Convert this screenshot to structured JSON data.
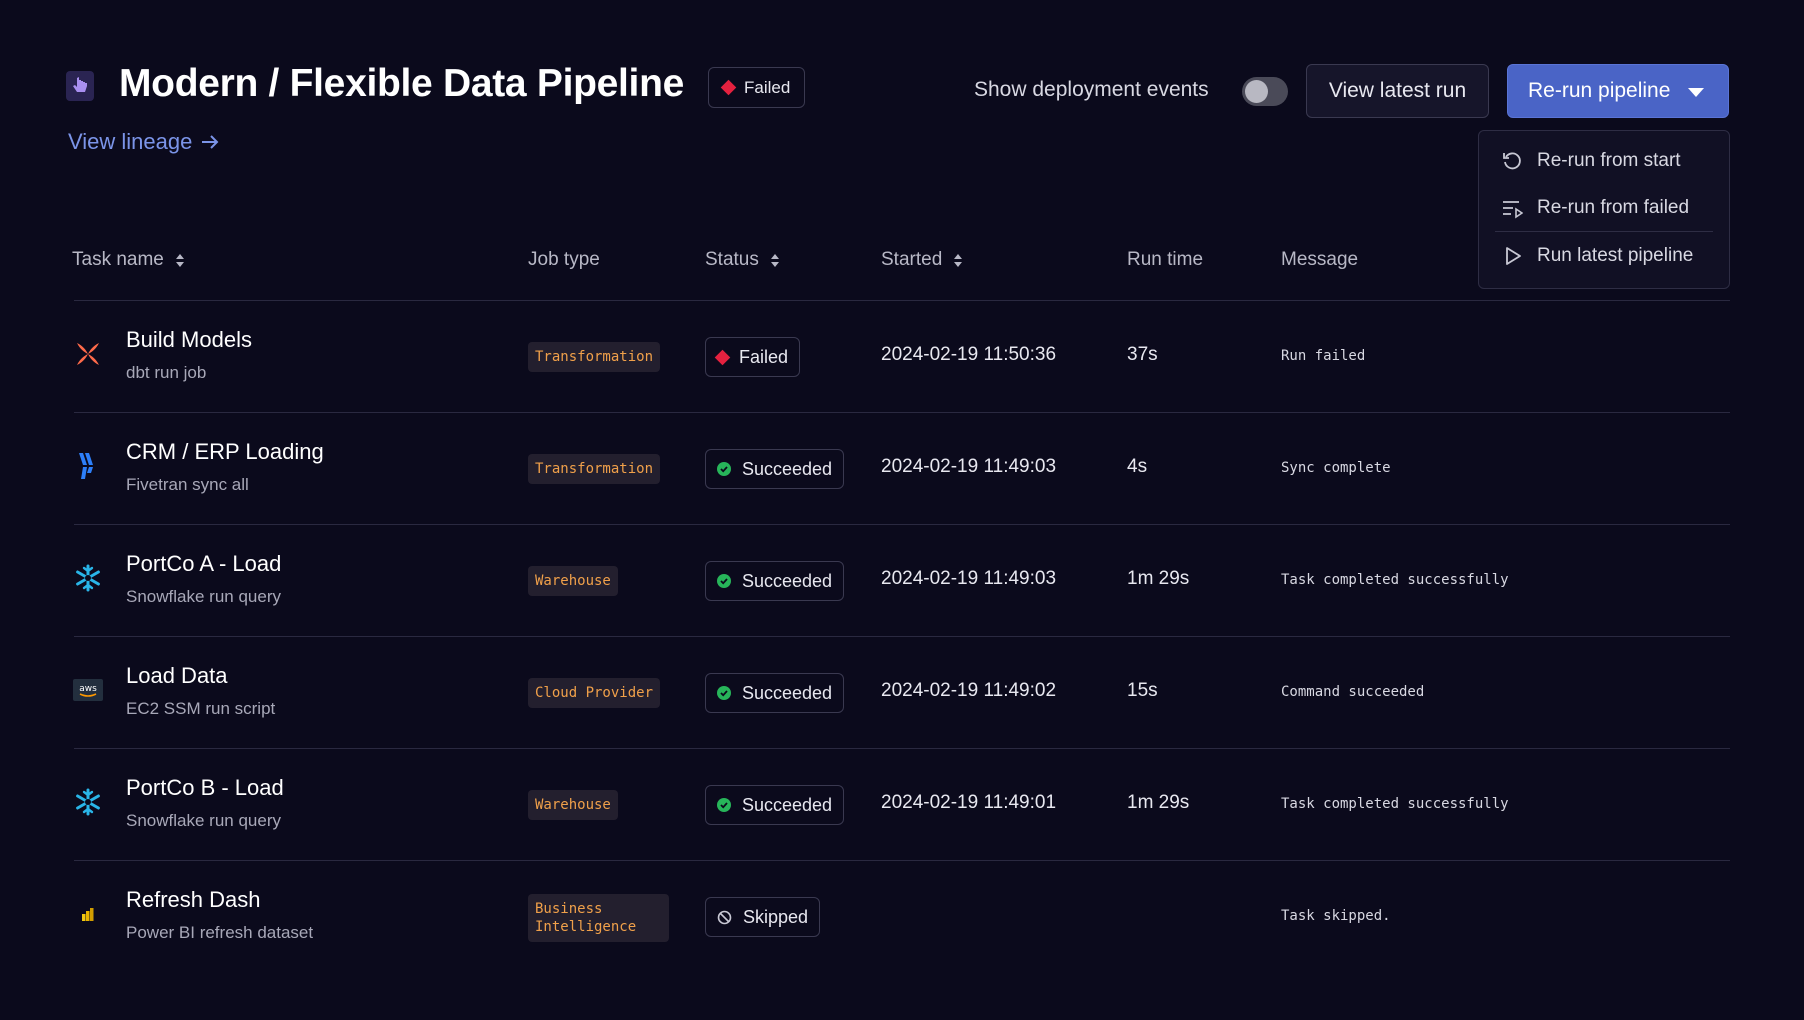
{
  "header": {
    "title": "Modern / Flexible Data Pipeline",
    "status_label": "Failed",
    "lineage_link": "View lineage",
    "toggle_label": "Show deployment events",
    "view_latest_label": "View latest run",
    "rerun_label": "Re-run pipeline"
  },
  "menu": {
    "items": [
      {
        "label": "Re-run from start",
        "icon": "restart-icon"
      },
      {
        "label": "Re-run from failed",
        "icon": "list-play-icon"
      },
      {
        "label": "Run latest pipeline",
        "icon": "play-icon"
      }
    ]
  },
  "table": {
    "columns": {
      "task": "Task name",
      "job_type": "Job type",
      "status": "Status",
      "started": "Started",
      "run_time": "Run time",
      "message": "Message"
    },
    "rows": [
      {
        "name": "Build Models",
        "sub": "dbt run job",
        "job_type": "Transformation",
        "status": "Failed",
        "started": "2024-02-19 11:50:36",
        "run_time": "37s",
        "message": "Run failed",
        "icon": "dbt-icon"
      },
      {
        "name": "CRM / ERP Loading",
        "sub": "Fivetran sync all",
        "job_type": "Transformation",
        "status": "Succeeded",
        "started": "2024-02-19 11:49:03",
        "run_time": "4s",
        "message": "Sync complete",
        "icon": "fivetran-icon"
      },
      {
        "name": "PortCo A - Load",
        "sub": "Snowflake run query",
        "job_type": "Warehouse",
        "status": "Succeeded",
        "started": "2024-02-19 11:49:03",
        "run_time": "1m 29s",
        "message": "Task completed successfully",
        "icon": "snowflake-icon"
      },
      {
        "name": "Load Data",
        "sub": "EC2 SSM run script",
        "job_type": "Cloud Provider",
        "status": "Succeeded",
        "started": "2024-02-19 11:49:02",
        "run_time": "15s",
        "message": "Command succeeded",
        "icon": "aws-icon"
      },
      {
        "name": "PortCo B - Load",
        "sub": "Snowflake run query",
        "job_type": "Warehouse",
        "status": "Succeeded",
        "started": "2024-02-19 11:49:01",
        "run_time": "1m 29s",
        "message": "Task completed successfully",
        "icon": "snowflake-icon"
      },
      {
        "name": "Refresh Dash",
        "sub": "Power BI refresh dataset",
        "job_type_line1": "Business",
        "job_type_line2": "Intelligence",
        "status": "Skipped",
        "started": "",
        "run_time": "",
        "message": "Task skipped.",
        "icon": "powerbi-icon"
      }
    ]
  },
  "colors": {
    "background": "#0b0a1c",
    "accent": "#4a64c6",
    "link": "#7b94e8",
    "failed": "#e5213f",
    "success": "#27b55a",
    "job_type_text": "#f0a04a"
  }
}
